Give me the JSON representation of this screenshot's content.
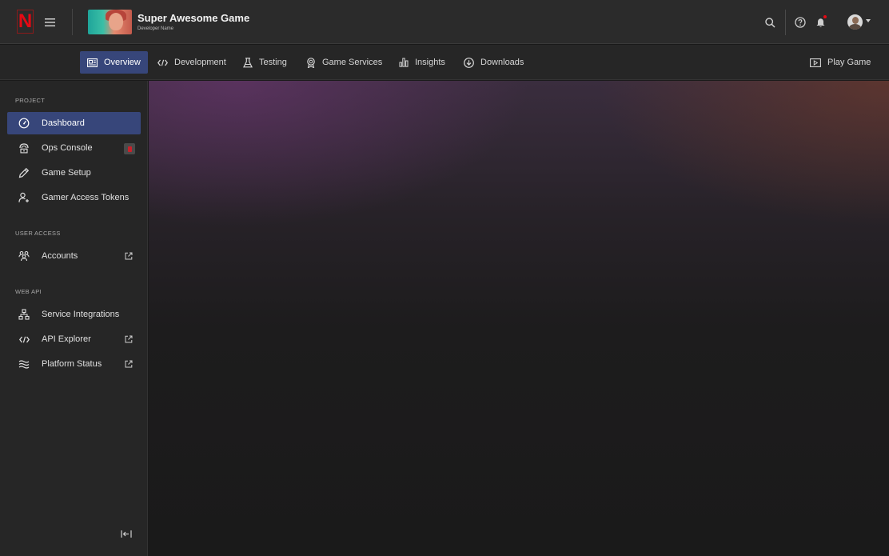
{
  "header": {
    "logo_letter": "N",
    "game_title": "Super Awesome Game",
    "developer_name": "Developer Name"
  },
  "nav": {
    "tabs": [
      {
        "label": "Overview",
        "icon": "overview-icon",
        "active": true
      },
      {
        "label": "Development",
        "icon": "code-icon"
      },
      {
        "label": "Testing",
        "icon": "flask-icon"
      },
      {
        "label": "Game Services",
        "icon": "badge-icon"
      },
      {
        "label": "Insights",
        "icon": "bar-chart-icon"
      },
      {
        "label": "Downloads",
        "icon": "download-icon"
      }
    ],
    "play_game": {
      "label": "Play Game",
      "icon": "play-screen-icon"
    }
  },
  "sidebar": {
    "sections": [
      {
        "label": "PROJECT",
        "items": [
          {
            "label": "Dashboard",
            "icon": "speedometer-icon",
            "active": true
          },
          {
            "label": "Ops Console",
            "icon": "ops-console-icon",
            "badge": true
          },
          {
            "label": "Game Setup",
            "icon": "pencil-icon"
          },
          {
            "label": "Gamer Access Tokens",
            "icon": "user-key-icon"
          }
        ]
      },
      {
        "label": "USER ACCESS",
        "items": [
          {
            "label": "Accounts",
            "icon": "people-icon",
            "external": true
          }
        ]
      },
      {
        "label": "WEB API",
        "items": [
          {
            "label": "Service Integrations",
            "icon": "network-icon"
          },
          {
            "label": "API Explorer",
            "icon": "code-icon",
            "external": true
          },
          {
            "label": "Platform Status",
            "icon": "waves-icon",
            "external": true
          }
        ]
      }
    ]
  },
  "colors": {
    "brand_red": "#e50914",
    "active_blue": "#37467a",
    "header_bg": "#2b2b2b",
    "sidebar_bg": "#262626",
    "main_bg": "#1a1a1a"
  }
}
